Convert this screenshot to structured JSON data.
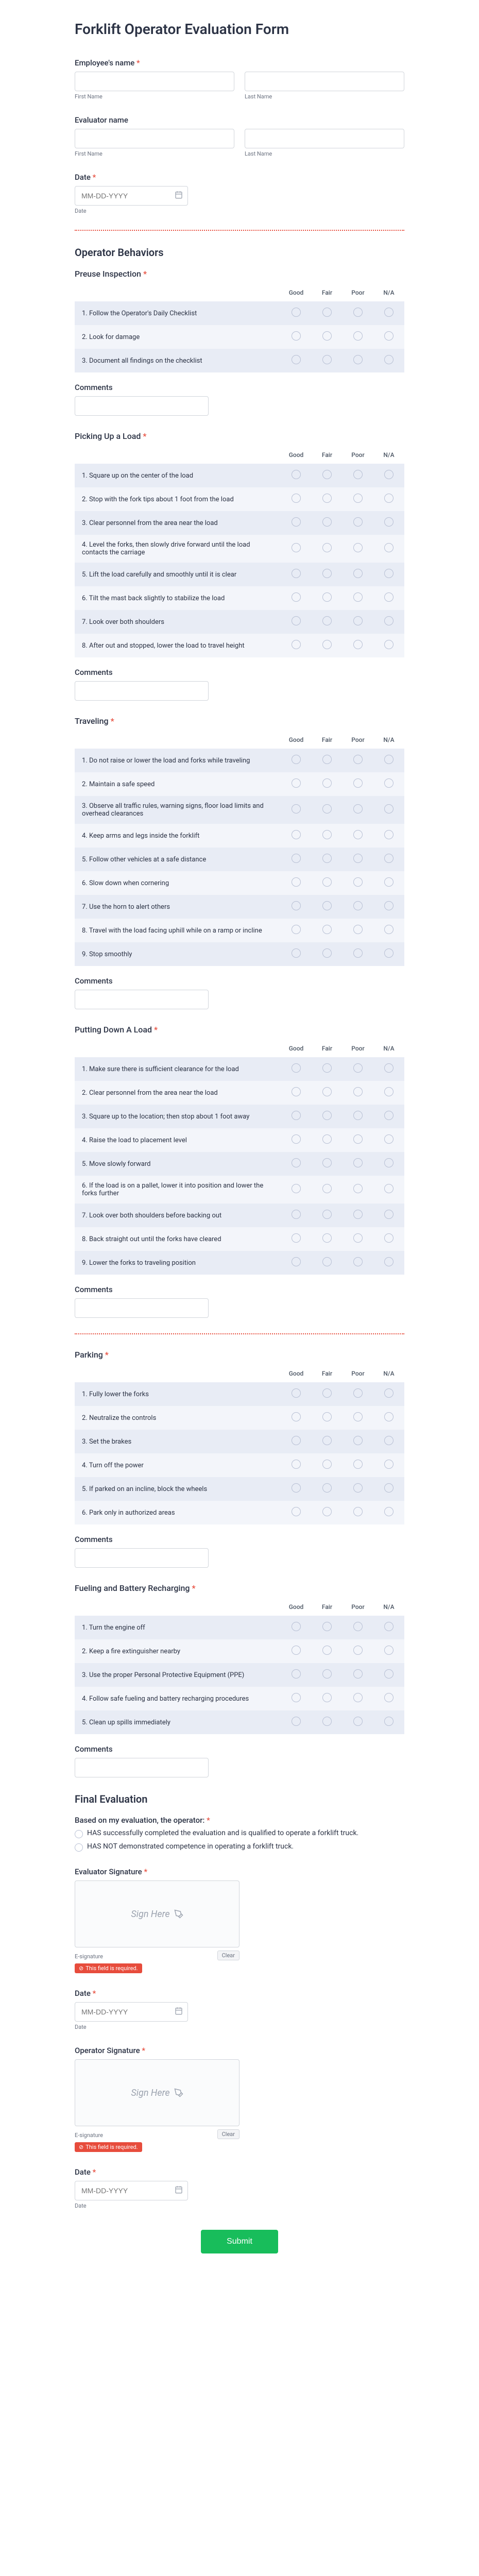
{
  "title": "Forklift Operator Evaluation Form",
  "employee": {
    "label": "Employee's name",
    "first_sub": "First Name",
    "last_sub": "Last Name"
  },
  "evaluator": {
    "label": "Evaluator name",
    "first_sub": "First Name",
    "last_sub": "Last Name"
  },
  "date": {
    "label": "Date",
    "placeholder": "MM-DD-YYYY",
    "sub": "Date"
  },
  "behaviors_heading": "Operator Behaviors",
  "rating_cols": [
    "Good",
    "Fair",
    "Poor",
    "N/A"
  ],
  "preuse": {
    "label": "Preuse Inspection",
    "rows": [
      "1. Follow the Operator's Daily Checklist",
      "2. Look for damage",
      "3. Document all findings on the checklist"
    ]
  },
  "comments_label": "Comments",
  "picking": {
    "label": "Picking Up a Load",
    "rows": [
      "1. Square up on the center of the load",
      "2. Stop with the fork tips about 1 foot from the load",
      "3. Clear personnel from the area near the load",
      "4. Level the forks, then slowly drive forward until the load contacts the carriage",
      "5. Lift the load carefully and smoothly until it is clear",
      "6. Tilt the mast back slightly to stabilize the load",
      "7. Look over both shoulders",
      "8. After out and stopped, lower the load to travel height"
    ]
  },
  "traveling": {
    "label": "Traveling",
    "rows": [
      "1. Do not raise or lower the load and forks while traveling",
      "2. Maintain a safe speed",
      "3. Observe all traffic rules, warning signs, floor load limits and overhead clearances",
      "4. Keep arms and legs inside the forklift",
      "5. Follow other vehicles at a safe distance",
      "6. Slow down when cornering",
      "7. Use the horn to alert others",
      "8. Travel with the load facing uphill while on a ramp or incline",
      "9. Stop smoothly"
    ]
  },
  "putting": {
    "label": "Putting Down A Load",
    "rows": [
      "1. Make sure there is sufficient clearance for the load",
      "2. Clear personnel from the area near the load",
      "3. Square up to the location; then stop about 1 foot away",
      "4. Raise the load to placement level",
      "5. Move slowly forward",
      "6. If the load is on a pallet, lower it into position and lower the forks further",
      "7. Look over both shoulders before backing out",
      "8. Back straight out until the forks have cleared",
      "9. Lower the forks to traveling position"
    ]
  },
  "parking": {
    "label": "Parking",
    "rows": [
      "1. Fully lower the forks",
      "2. Neutralize the controls",
      "3. Set the brakes",
      "4. Turn off the power",
      "5. If parked on an incline, block the wheels",
      "6. Park only in authorized areas"
    ]
  },
  "fueling": {
    "label": "Fueling and Battery Recharging",
    "rows": [
      "1. Turn the engine off",
      "2. Keep a fire extinguisher nearby",
      "3. Use the proper Personal Protective Equipment (PPE)",
      "4. Follow safe fueling and battery recharging procedures",
      "5. Clean up spills immediately"
    ]
  },
  "final": {
    "heading": "Final Evaluation",
    "prompt": "Based on my evaluation, the operator:",
    "opt1": "HAS successfully completed the evaluation and is qualified to operate a forklift truck.",
    "opt2": "HAS NOT demonstrated competence in operating a forklift truck."
  },
  "eval_sig": {
    "label": "Evaluator Signature",
    "placeholder": "Sign Here",
    "sub": "E-signature",
    "clear": "Clear",
    "error": "This field is required."
  },
  "op_sig": {
    "label": "Operator Signature",
    "placeholder": "Sign Here",
    "sub": "E-signature",
    "clear": "Clear",
    "error": "This field is required."
  },
  "date2": {
    "label": "Date",
    "placeholder": "MM-DD-YYYY",
    "sub": "Date"
  },
  "date3": {
    "label": "Date",
    "placeholder": "MM-DD-YYYY",
    "sub": "Date"
  },
  "submit": "Submit"
}
